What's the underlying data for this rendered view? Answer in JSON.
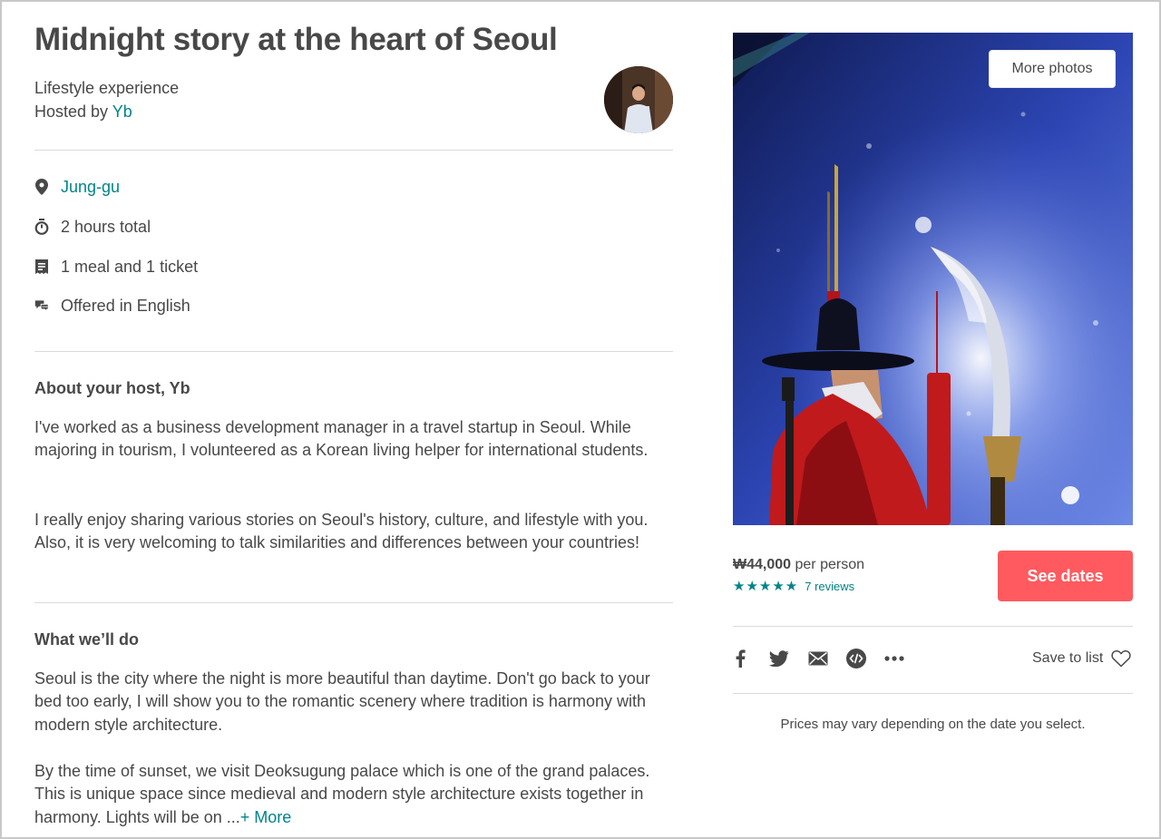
{
  "listing": {
    "title": "Midnight story at the heart of Seoul",
    "category": "Lifestyle experience",
    "hosted_prefix": "Hosted by ",
    "host_name": "Yb"
  },
  "details": [
    {
      "icon": "location-pin-icon",
      "text": "Jung-gu"
    },
    {
      "icon": "clock-icon",
      "text": "2 hours total"
    },
    {
      "icon": "receipt-icon",
      "text": "1 meal and 1 ticket"
    },
    {
      "icon": "chat-bubbles-icon",
      "text": "Offered in English"
    }
  ],
  "about": {
    "heading": "About your host, Yb",
    "paragraphs": [
      "I've worked as a business development manager in a travel startup in Seoul. While majoring in tourism, I volunteered as a Korean living helper for international students.",
      "I really enjoy sharing various stories on Seoul's history, culture, and lifestyle with you. Also, it is very welcoming to talk similarities and differences between your countries!"
    ]
  },
  "what": {
    "heading": "What we’ll do",
    "paragraphs": [
      "Seoul is the city where the night is more beautiful than daytime. Don't go back to your bed too early, I will show you to the romantic scenery where tradition is harmony with modern style architecture.",
      "By the time of sunset, we visit Deoksugung palace which is one of the grand palaces. This is unique space since medieval and modern style architecture exists together in harmony. Lights will be on ..."
    ],
    "more_label": "+ More"
  },
  "photo": {
    "more_photos_label": "More photos"
  },
  "booking": {
    "price": "₩44,000",
    "per_person": " per person",
    "stars": "★★★★★",
    "rating": 5,
    "reviews": "7 reviews",
    "cta": "See dates",
    "save_label": "Save to list",
    "note": "Prices may vary depending on the date you select.",
    "share_icons": [
      "facebook-icon",
      "twitter-icon",
      "email-icon",
      "embed-icon",
      "more-options-icon"
    ]
  },
  "colors": {
    "accent": "#008489",
    "cta": "#ff5a5f",
    "text": "#484848"
  }
}
